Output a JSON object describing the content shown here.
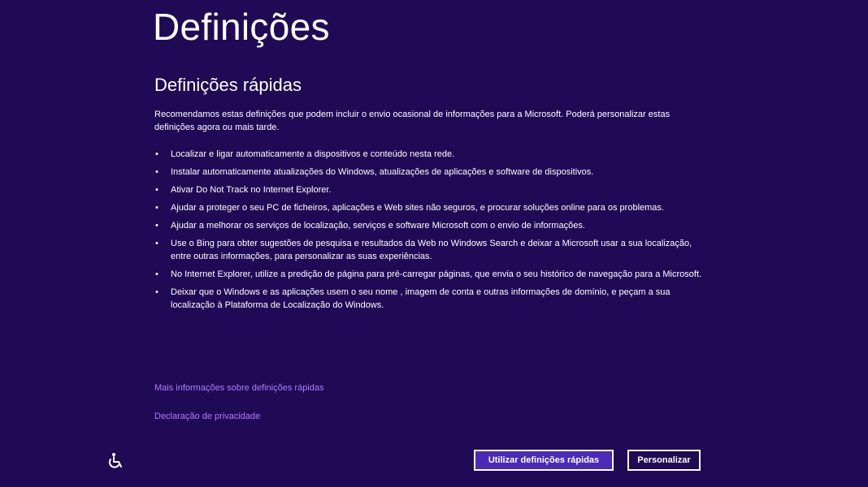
{
  "header": {
    "title": "Definições"
  },
  "main": {
    "section_title": "Definições rápidas",
    "intro": "Recomendamos estas definições que podem incluir o envio ocasional de informações para a Microsoft. Poderá personalizar estas definições agora ou mais tarde.",
    "bullets": [
      "Localizar e ligar automaticamente a dispositivos e conteúdo nesta rede.",
      "Instalar automaticamente atualizações do Windows, atualizações de aplicações e software de dispositivos.",
      "Ativar Do Not Track no Internet Explorer.",
      "Ajudar a proteger o seu PC de ficheiros, aplicações e Web sites não seguros, e procurar soluções online para os problemas.",
      "Ajudar a melhorar os serviços de localização, serviços e software Microsoft com o envio de informações.",
      "Use o Bing para obter sugestões de pesquisa e resultados da Web no Windows Search e deixar a Microsoft usar a sua localização, entre outras informações, para personalizar as suas experiências.",
      "No Internet Explorer, utilize a predição de página para pré-carregar páginas, que envia o seu histórico de navegação para a Microsoft.",
      "Deixar que o Windows e as aplicações usem o seu nome , imagem de conta e outras informações de domínio, e peçam a sua localização à Plataforma de Localização do Windows."
    ],
    "links": {
      "more_info": "Mais informações sobre definições rápidas",
      "privacy": "Declaração de privacidade"
    }
  },
  "footer": {
    "ease_of_access_icon": "ease-of-access-icon",
    "primary_button": "Utilizar definições rápidas",
    "secondary_button": "Personalizar"
  },
  "colors": {
    "background": "#200a55",
    "link": "#b07cff",
    "primary_button": "#4a2bb8"
  }
}
